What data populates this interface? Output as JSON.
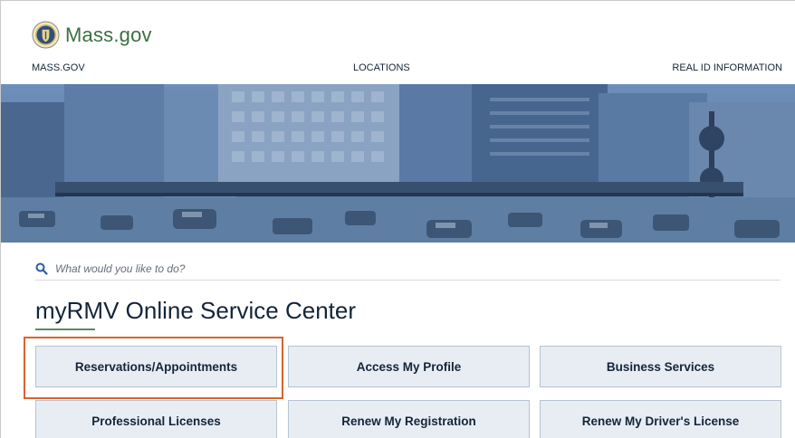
{
  "brand": {
    "name": "Mass.gov",
    "logo_icon": "massachusetts-seal-icon"
  },
  "nav": {
    "items": [
      "MASS.GOV",
      "LOCATIONS",
      "REAL ID INFORMATION"
    ]
  },
  "hero": {
    "description_icon": "city-highway-banner-image"
  },
  "search": {
    "placeholder": "What would you like to do?",
    "icon": "search-icon"
  },
  "page": {
    "title": "myRMV Online Service Center"
  },
  "services": [
    "Reservations/Appointments",
    "Access My Profile",
    "Business Services",
    "Professional Licenses",
    "Renew My Registration",
    "Renew My Driver's License"
  ],
  "colors": {
    "accent": "#d8642c",
    "brand_green": "#3c6f43",
    "button_bg": "#e8edf4",
    "text": "#14253a"
  }
}
